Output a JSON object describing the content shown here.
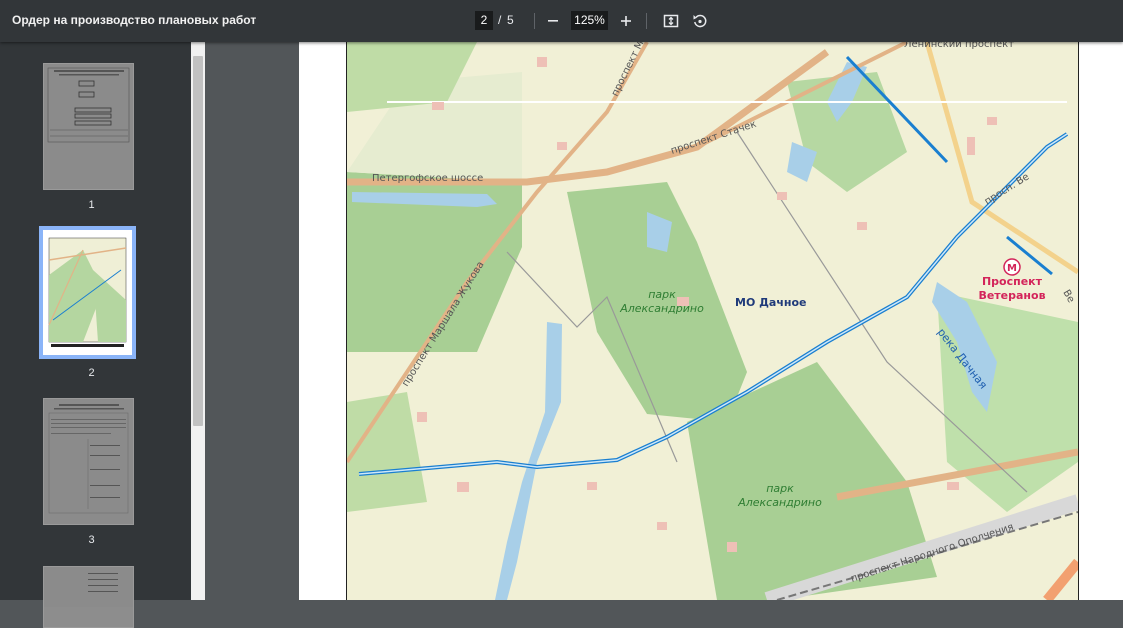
{
  "toolbar": {
    "title": "Ордер на производство плановых работ",
    "current_page": "2",
    "separator": "/",
    "total_pages": "5",
    "zoom": "125%",
    "icons": [
      "minus-icon",
      "plus-icon",
      "fit-page-icon",
      "rotate-icon"
    ]
  },
  "thumbnails": [
    {
      "label": "1",
      "active": false
    },
    {
      "label": "2",
      "active": true
    },
    {
      "label": "3",
      "active": false
    }
  ],
  "map": {
    "streets": {
      "peterhof": "Петергофское шоссе",
      "stachek": "проспект Стачек",
      "zhukov": "проспект Маршала Жукова",
      "zhukov_top": "проспект М",
      "top_right": "Ленинский проспект",
      "opolcheniya": "проспект Народного Ополчения",
      "right_vet": "просп. Ве",
      "edge": "Ве"
    },
    "parks": {
      "park1_line1": "парк",
      "park1_line2": "Александрино",
      "park2_line1": "парк",
      "park2_line2": "Александрино"
    },
    "district": "МО Дачное",
    "river": "река Дачная",
    "metro": {
      "symbol": "М",
      "line1": "Проспект",
      "line2": "Ветеранов"
    },
    "colors": {
      "land": "#f1f0d6",
      "park": "#a8cf94",
      "water": "#a8cfe8",
      "road": "#e2b387",
      "route": "#1a7fd0",
      "metro": "#d3245a"
    }
  }
}
